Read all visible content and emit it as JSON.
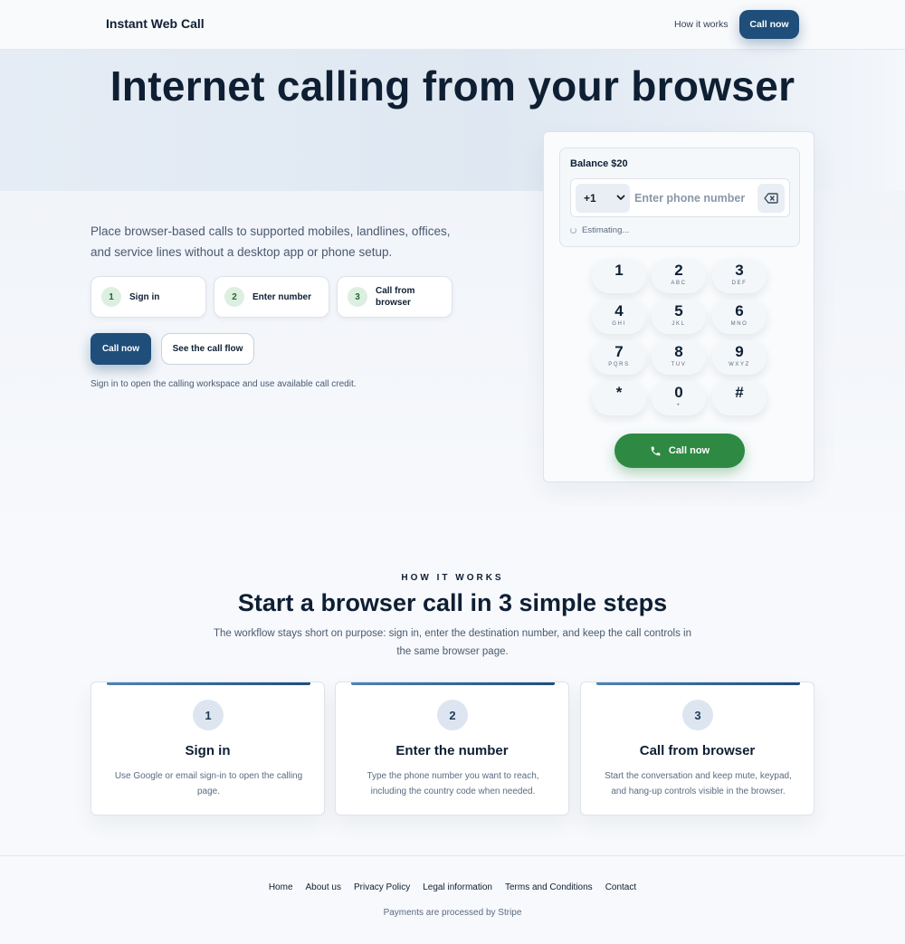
{
  "header": {
    "brand": "Instant Web Call",
    "nav_link": "How it works",
    "cta": "Call now"
  },
  "hero": {
    "title": "Internet calling from your browser",
    "description": "Place browser-based calls to supported mobiles, landlines, offices, and service lines without a desktop app or phone setup.",
    "steps": [
      {
        "num": "1",
        "label": "Sign in"
      },
      {
        "num": "2",
        "label": "Enter number"
      },
      {
        "num": "3",
        "label": "Call from browser"
      }
    ],
    "primary_cta": "Call now",
    "secondary_cta": "See the call flow",
    "note": "Sign in to open the calling workspace and use available call credit."
  },
  "dialer": {
    "balance": "Balance $20",
    "country_code": "+1",
    "phone_placeholder": "Enter phone number",
    "estimating": "Estimating...",
    "keys": [
      {
        "digit": "1",
        "letters": ""
      },
      {
        "digit": "2",
        "letters": "ABC"
      },
      {
        "digit": "3",
        "letters": "DEF"
      },
      {
        "digit": "4",
        "letters": "GHI"
      },
      {
        "digit": "5",
        "letters": "JKL"
      },
      {
        "digit": "6",
        "letters": "MNO"
      },
      {
        "digit": "7",
        "letters": "PQRS"
      },
      {
        "digit": "8",
        "letters": "TUV"
      },
      {
        "digit": "9",
        "letters": "WXYZ"
      },
      {
        "digit": "*",
        "letters": ""
      },
      {
        "digit": "0",
        "letters": "+"
      },
      {
        "digit": "#",
        "letters": ""
      }
    ],
    "call_button": "Call now"
  },
  "how_it_works": {
    "eyebrow": "HOW IT WORKS",
    "title": "Start a browser call in 3 simple steps",
    "description": "The workflow stays short on purpose: sign in, enter the destination number, and keep the call controls in the same browser page.",
    "cards": [
      {
        "num": "1",
        "title": "Sign in",
        "text": "Use Google or email sign-in to open the calling page."
      },
      {
        "num": "2",
        "title": "Enter the number",
        "text": "Type the phone number you want to reach, including the country code when needed."
      },
      {
        "num": "3",
        "title": "Call from browser",
        "text": "Start the conversation and keep mute, keypad, and hang-up controls visible in the browser."
      }
    ]
  },
  "footer": {
    "links": [
      "Home",
      "About us",
      "Privacy Policy",
      "Legal information",
      "Terms and Conditions",
      "Contact"
    ],
    "note": "Payments are processed by Stripe"
  },
  "colors": {
    "primary": "#1f4e7a",
    "call_green": "#2e8a43",
    "step_badge": "#dcefe0"
  }
}
